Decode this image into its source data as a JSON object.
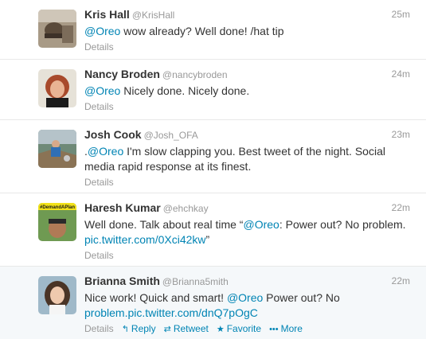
{
  "tweets": [
    {
      "fullname": "Kris Hall",
      "username": "@KrisHall",
      "time": "25m",
      "text": [
        {
          "t": "@Oreo",
          "link": true
        },
        {
          "t": " wow already? Well done! /hat tip",
          "link": false
        }
      ],
      "details": "Details"
    },
    {
      "fullname": "Nancy Broden",
      "username": "@nancybroden",
      "time": "24m",
      "text": [
        {
          "t": "@Oreo",
          "link": true
        },
        {
          "t": " Nicely done. Nicely done.",
          "link": false
        }
      ],
      "details": "Details"
    },
    {
      "fullname": "Josh Cook",
      "username": "@Josh_OFA",
      "time": "23m",
      "text": [
        {
          "t": ".",
          "link": false
        },
        {
          "t": "@Oreo",
          "link": true
        },
        {
          "t": " I'm slow clapping you. Best tweet of the night. Social media rapid response at its finest.",
          "link": false
        }
      ],
      "details": "Details"
    },
    {
      "fullname": "Haresh Kumar",
      "username": "@ehchkay",
      "time": "22m",
      "avatar_label": "#DemandAPlan",
      "text": [
        {
          "t": "Well done. Talk about real time “",
          "link": false
        },
        {
          "t": "@Oreo",
          "link": true
        },
        {
          "t": ": Power out? No problem. ",
          "link": false
        },
        {
          "t": "pic.twitter.com/0Xci42kw",
          "link": true
        },
        {
          "t": "”",
          "link": false
        }
      ],
      "details": "Details"
    },
    {
      "fullname": "Brianna Smith",
      "username": "@Brianna5mith",
      "time": "22m",
      "text": [
        {
          "t": "Nice work! Quick and smart! ",
          "link": false
        },
        {
          "t": "@Oreo",
          "link": true
        },
        {
          "t": " Power out? No ",
          "link": false
        },
        {
          "t": "problem.pic.twitter.com/dnQ7pOgC",
          "link": true
        }
      ],
      "details": "Details",
      "actions": {
        "reply": "Reply",
        "retweet": "Retweet",
        "favorite": "Favorite",
        "more": "More"
      }
    }
  ],
  "colors": {
    "link": "#0084b4",
    "muted": "#999999",
    "text": "#333333",
    "highlight_bg": "#f5f8fa"
  },
  "icons": {
    "reply": "reply-icon",
    "retweet": "retweet-icon",
    "favorite": "star-icon",
    "more": "more-icon"
  }
}
